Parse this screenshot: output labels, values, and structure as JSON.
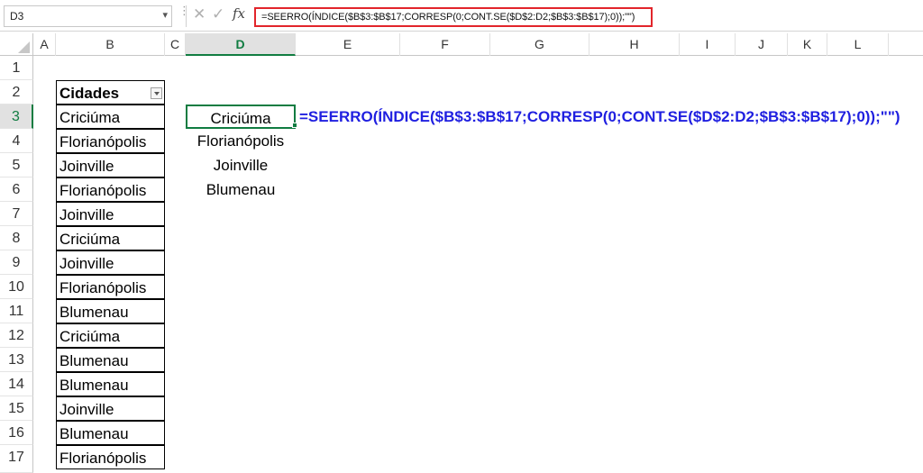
{
  "name_box": {
    "value": "D3"
  },
  "formula_bar": {
    "formula": "=SEERRO(ÍNDICE($B$3:$B$17;CORRESP(0;CONT.SE($D$2:D2;$B$3:$B$17);0));\"\")",
    "highlight_color": "#e2252b"
  },
  "columns": [
    "A",
    "B",
    "C",
    "D",
    "E",
    "F",
    "G",
    "H",
    "I",
    "J",
    "K",
    "L"
  ],
  "active_column": "D",
  "rows": [
    "1",
    "2",
    "3",
    "4",
    "5",
    "6",
    "7",
    "8",
    "9",
    "10",
    "11",
    "12",
    "13",
    "14",
    "15",
    "16",
    "17"
  ],
  "active_row": "3",
  "column_b": {
    "header": "Cidades",
    "values": [
      "Criciúma",
      "Florianópolis",
      "Joinville",
      "Florianópolis",
      "Joinville",
      "Criciúma",
      "Joinville",
      "Florianópolis",
      "Blumenau",
      "Criciúma",
      "Blumenau",
      "Blumenau",
      "Joinville",
      "Blumenau",
      "Florianópolis"
    ]
  },
  "column_d": {
    "values": [
      "Criciúma",
      "Florianópolis",
      "Joinville",
      "Blumenau"
    ]
  },
  "annotation": {
    "text": "=SEERRO(ÍNDICE($B$3:$B$17;CORRESP(0;CONT.SE($D$2:D2;$B$3:$B$17);0));\"\")",
    "color": "#1f1fe0"
  },
  "accent_color": "#107c41",
  "icons": {
    "cancel": "cancel-icon",
    "enter": "enter-icon",
    "function": "fx-icon",
    "dropdown": "chevron-down-icon"
  }
}
